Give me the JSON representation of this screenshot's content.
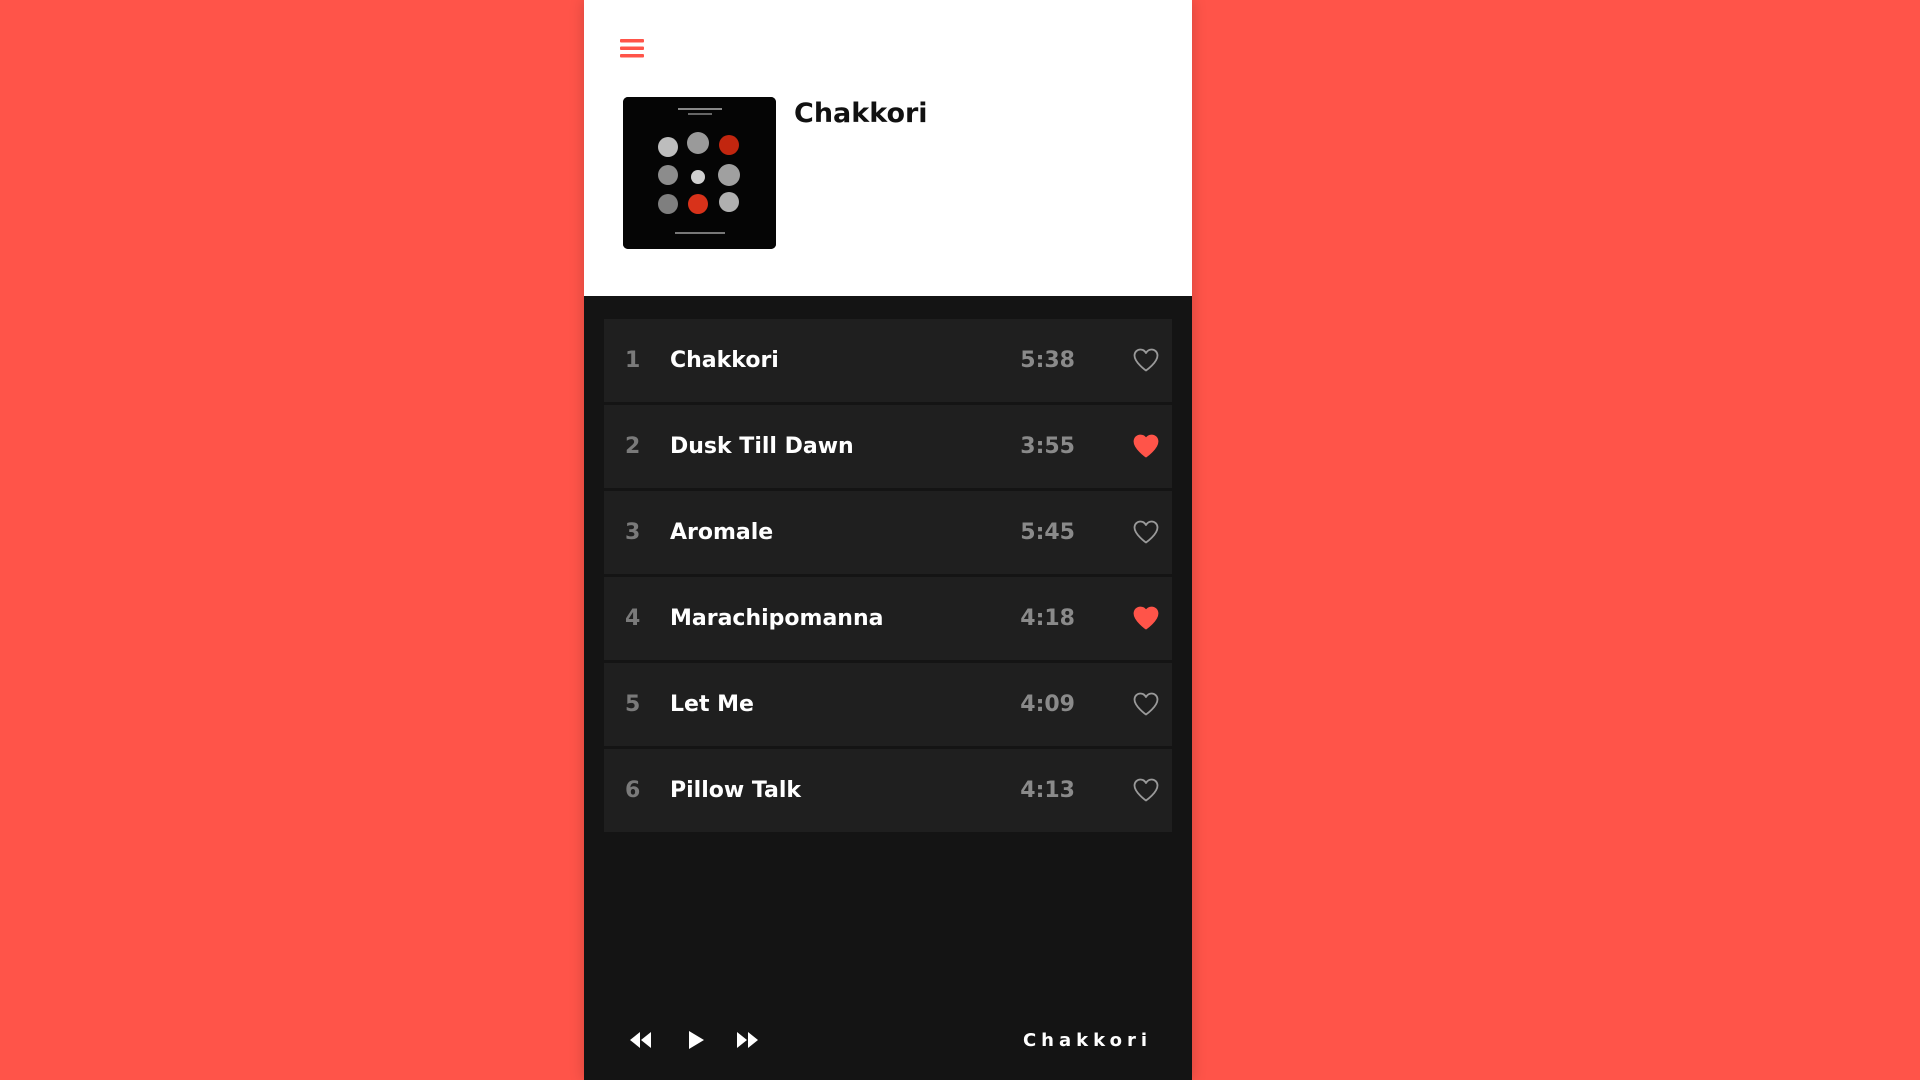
{
  "colors": {
    "accent": "#ff5449",
    "panel_dark": "#141414",
    "row_bg": "#1f1f1f",
    "header_bg": "#ffffff"
  },
  "header": {
    "menu_icon": "hamburger-menu-icon",
    "album_title": "Chakkori"
  },
  "tracks": [
    {
      "number": "1",
      "title": "Chakkori",
      "duration": "5:38",
      "liked": false
    },
    {
      "number": "2",
      "title": "Dusk Till Dawn",
      "duration": "3:55",
      "liked": true
    },
    {
      "number": "3",
      "title": "Aromale",
      "duration": "5:45",
      "liked": false
    },
    {
      "number": "4",
      "title": "Marachipomanna",
      "duration": "4:18",
      "liked": true
    },
    {
      "number": "5",
      "title": "Let Me",
      "duration": "4:09",
      "liked": false
    },
    {
      "number": "6",
      "title": "Pillow Talk",
      "duration": "4:13",
      "liked": false
    }
  ],
  "player": {
    "prev_icon": "rewind-icon",
    "play_icon": "play-icon",
    "next_icon": "fast-forward-icon",
    "now_playing": "Chakkori"
  }
}
